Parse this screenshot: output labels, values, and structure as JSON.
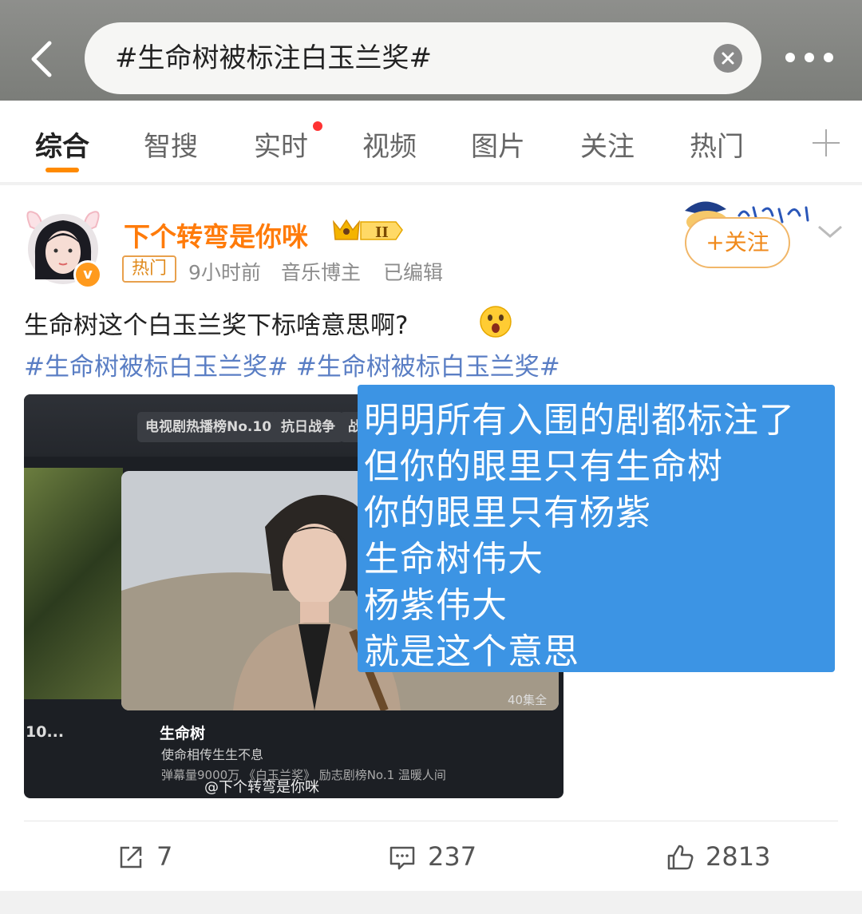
{
  "search": {
    "query": "#生命树被标注白玉兰奖#"
  },
  "tabs": [
    {
      "label": "综合",
      "active": true
    },
    {
      "label": "智搜"
    },
    {
      "label": "实时",
      "dot": true
    },
    {
      "label": "视频"
    },
    {
      "label": "图片"
    },
    {
      "label": "关注"
    },
    {
      "label": "热门"
    }
  ],
  "post": {
    "username": "下个转弯是你咪",
    "badge_level": "II",
    "hot_tag": "热门",
    "time": "9小时前",
    "identity": "音乐博主",
    "edited": "已编辑",
    "follow_label": "+关注",
    "text": "生命树这个白玉兰奖下标啥意思啊?",
    "hashtags": [
      "#生命树被标白玉兰奖#",
      "#生命树被标白玉兰奖#"
    ],
    "image": {
      "chips": [
        "电视剧热播榜No.10",
        "抗日战争",
        "战"
      ],
      "episodes": "40集全",
      "title": "生命树",
      "subtitle": "使命相传生生不息",
      "left_label": "10...",
      "bottom_chips": "弹幕量9000万  《白玉兰奖》  励志剧榜No.1  温暖人间",
      "watermark": "@下个转弯是你咪"
    },
    "overlay_lines": [
      "明明所有入围的剧都标注了",
      "但你的眼里只有生命树",
      "你的眼里只有杨紫",
      "生命树伟大",
      "杨紫伟大",
      "就是这个意思"
    ],
    "actions": {
      "share": "7",
      "comments": "237",
      "likes": "2813"
    }
  },
  "colors": {
    "accent": "#ff8a00",
    "link": "#5a7ec4",
    "username": "#ff7b0a",
    "overlay": "#3c94e4"
  }
}
